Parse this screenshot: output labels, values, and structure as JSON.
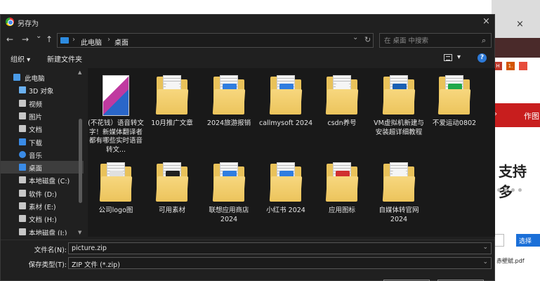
{
  "background": {
    "close_glyph": "×",
    "badges": [
      {
        "text": "H",
        "color": "#c0392b"
      },
      {
        "text": "1.",
        "color": "#d35400"
      },
      {
        "text": "",
        "color": "#e74c3c"
      }
    ],
    "red_bar_label": "作图",
    "red_bar_chevron": "›",
    "support_text": "支持多",
    "select_button": "选择",
    "pdf_name": "赤壁赋.pdf"
  },
  "dialog": {
    "title": "另存为",
    "close": "×"
  },
  "nav": {
    "back": "←",
    "forward": "→",
    "down": "⌄",
    "up": "↑",
    "path": [
      "此电脑",
      "桌面"
    ],
    "path_sep": "›",
    "refresh": "↻",
    "dropdown": "⌄"
  },
  "search": {
    "placeholder": "在 桌面 中搜索",
    "icon": "⌕"
  },
  "toolbar": {
    "organize": "组织 ▾",
    "new_folder": "新建文件夹",
    "view_dd": "▾",
    "help": "?"
  },
  "sidebar": {
    "items": [
      {
        "label": "此电脑",
        "icon": "computer-icon",
        "color": "#4a9be8",
        "indent": 0
      },
      {
        "label": "3D 对象",
        "icon": "cube-icon",
        "color": "#6ab0f0",
        "indent": 1
      },
      {
        "label": "视频",
        "icon": "video-icon",
        "color": "#c7c7c7",
        "indent": 1
      },
      {
        "label": "图片",
        "icon": "picture-icon",
        "color": "#c7c7c7",
        "indent": 1
      },
      {
        "label": "文档",
        "icon": "document-icon",
        "color": "#c7c7c7",
        "indent": 1
      },
      {
        "label": "下载",
        "icon": "download-icon",
        "color": "#3a8be6",
        "indent": 1
      },
      {
        "label": "音乐",
        "icon": "music-icon",
        "color": "#3a8be6",
        "indent": 1
      },
      {
        "label": "桌面",
        "icon": "desktop-icon",
        "color": "#3a8be6",
        "indent": 1
      },
      {
        "label": "本地磁盘 (C:)",
        "icon": "drive-icon",
        "color": "#c7c7c7",
        "indent": 1
      },
      {
        "label": "软件 (D:)",
        "icon": "drive-icon",
        "color": "#c7c7c7",
        "indent": 1
      },
      {
        "label": "素材 (E:)",
        "icon": "drive-icon",
        "color": "#c7c7c7",
        "indent": 1
      },
      {
        "label": "文档 (H:)",
        "icon": "drive-icon",
        "color": "#c7c7c7",
        "indent": 1
      },
      {
        "label": "本地磁盘 (J:)",
        "icon": "drive-icon",
        "color": "#c7c7c7",
        "indent": 1
      }
    ],
    "selected": "桌面",
    "scroll_up": "▲",
    "scroll_down": "▼"
  },
  "files": [
    {
      "name": "(不花钱）语音转文字！新媒体翻译者都有哪些实时语音转文...",
      "kind": "image-doc",
      "accent": "#c03aa0"
    },
    {
      "name": "10月推广文章",
      "kind": "folder",
      "accent": "#f5f5f5"
    },
    {
      "name": "2024旅游报销",
      "kind": "folder",
      "accent": "#2f7de0"
    },
    {
      "name": "callmysoft 2024",
      "kind": "folder",
      "accent": "#2f7de0"
    },
    {
      "name": "csdn养号",
      "kind": "folder",
      "accent": "#f5f5f5"
    },
    {
      "name": "VM虚拟机新建与安装超详细教程",
      "kind": "folder",
      "accent": "#1a5fb4"
    },
    {
      "name": "不爱运动0802",
      "kind": "folder",
      "accent": "#1fa84a"
    },
    {
      "name": "公司logo图",
      "kind": "folder",
      "accent": "#e0e0e0"
    },
    {
      "name": "可用素材",
      "kind": "folder",
      "accent": "#202020"
    },
    {
      "name": "联想应用商店 2024",
      "kind": "folder",
      "accent": "#2f7de0"
    },
    {
      "name": "小红书 2024",
      "kind": "folder",
      "accent": "#2f7de0"
    },
    {
      "name": "应用图标",
      "kind": "folder",
      "accent": "#d03030"
    },
    {
      "name": "自媒体转官网 2024",
      "kind": "folder",
      "accent": "#f5f5f5"
    }
  ],
  "footer": {
    "filename_label": "文件名(N):",
    "filename_value": "picture.zip",
    "filetype_label": "保存类型(T):",
    "filetype_value": "ZIP 文件 (*.zip)",
    "combo": "⌄"
  }
}
